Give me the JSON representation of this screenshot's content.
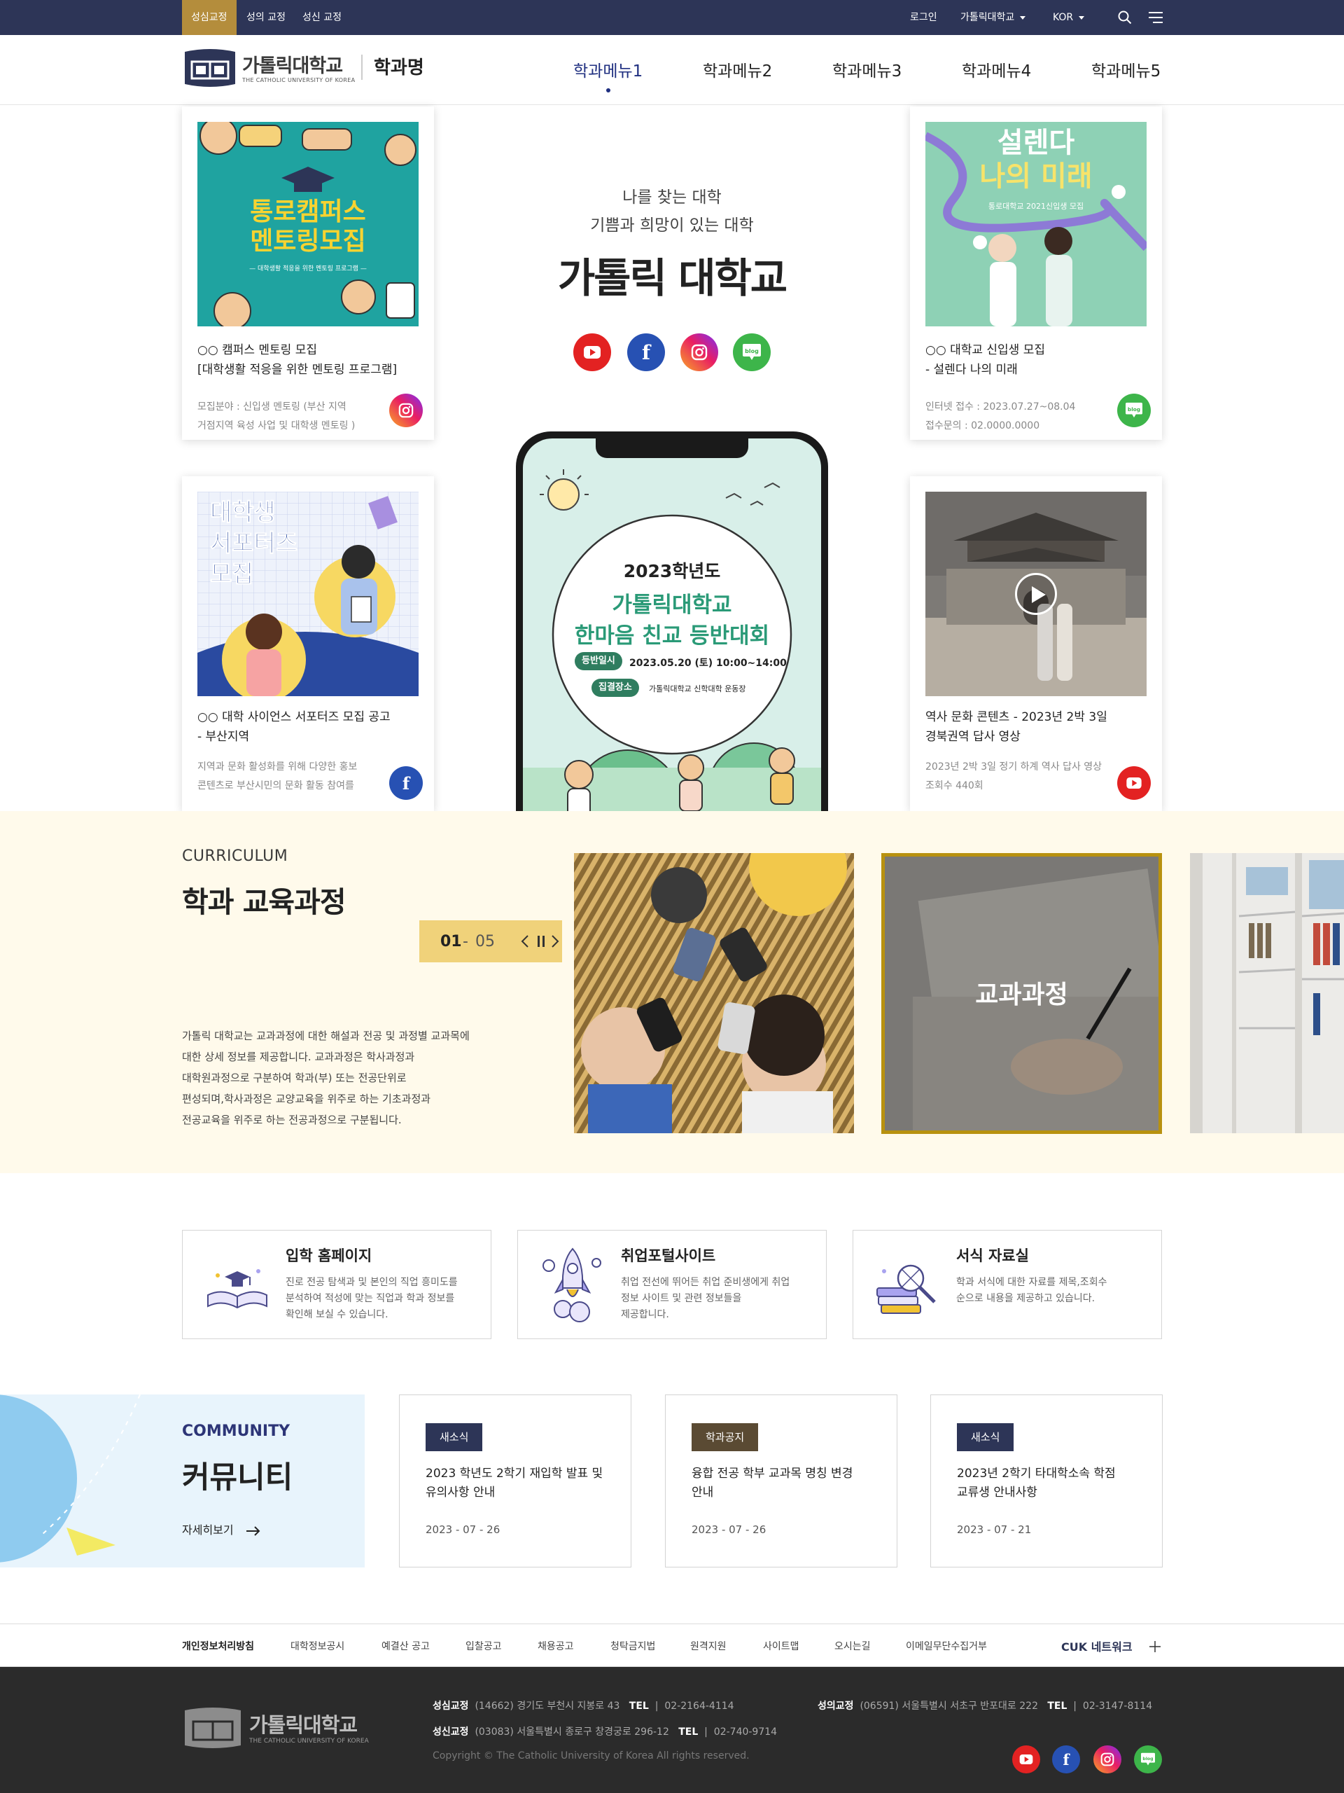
{
  "util": {
    "campuses": [
      "성심교정",
      "성의 교정",
      "성신 교정"
    ],
    "login": "로그인",
    "univ_select": "가톨릭대학교",
    "lang": "KOR"
  },
  "header": {
    "logo_ko": "가톨릭대학교",
    "logo_en": "THE CATHOLIC UNIVERSITY OF KOREA",
    "dept": "학과명",
    "menus": [
      "학과메뉴1",
      "학과메뉴2",
      "학과메뉴3",
      "학과메뉴4",
      "학과메뉴5"
    ]
  },
  "intro": {
    "line1": "나를 찾는 대학",
    "line2": "기쁨과 희망이 있는 대학",
    "title": "가톨릭 대학교"
  },
  "cards": [
    {
      "thumb_l1": "통로캠퍼스",
      "thumb_l2": "멘토링모집",
      "thumb_sub": "— 대학생활 적응을 위한 멘토링 프로그램 —",
      "title_l1": "○○ 캠퍼스 멘토링 모집",
      "title_l2": "[대학생활 적응을 위한 멘토링 프로그램]",
      "desc_l1": "모집분야 : 신입생 멘토링 (부산 지역",
      "desc_l2": "거점지역 육성 사업 및 대학생 멘토링 )",
      "sns": "instagram-icon"
    },
    {
      "thumb_l1": "설렌다",
      "thumb_l2": "나의 미래",
      "thumb_sub": "통로대학교 2021신입생 모집",
      "title_l1": "○○ 대학교 신입생 모집",
      "title_l2": "- 설렌다 나의 미래",
      "desc_l1": "인터넷 접수 : 2023.07.27~08.04",
      "desc_l2": "접수문의 : 02.0000.0000",
      "sns": "blog-icon"
    },
    {
      "thumb_l1": "대학생",
      "thumb_l2": "서포터즈",
      "thumb_l3": "모집",
      "title_l1": "○○ 대학 사이언스 서포터즈 모집 공고",
      "title_l2": "- 부산지역",
      "desc_l1": "지역과 문화 활성화를 위해 다양한 홍보",
      "desc_l2": "콘텐츠로 부산시민의 문화 활동 참여를",
      "sns": "facebook-icon"
    },
    {
      "title_l1": "역사 문화 콘텐츠 -  2023년 2박 3일",
      "title_l2": "경북권역 답사 영상",
      "desc_l1": "2023년 2박 3일 정기 하계 역사 답사 영상",
      "desc_l2": "조회수 440회",
      "sns": "youtube-icon"
    }
  ],
  "phone": {
    "year": "2023학년도",
    "t1": "가톨릭대학교",
    "t2": "한마음 친교 등반대회",
    "k1": "등반일시",
    "v1": "2023.05.20 (토) 10:00~14:00",
    "k2": "집결장소",
    "v2": "가톨릭대학교 신학대학 운동장"
  },
  "curriculum": {
    "eyebrow": "CURRICULUM",
    "title": "학과 교육과정",
    "page_cur": "01",
    "page_sep": "-",
    "page_total": "05",
    "desc": [
      "가톨릭 대학교는 교과과정에 대한 해설과 전공 및 과정별 교과목에",
      "대한 상세 정보를 제공합니다. 교과과정은 학사과정과",
      "대학원과정으로 구분하여 학과(부) 또는 전공단위로",
      "편성되며,학사과정은 교양교육을 위주로 하는 기초과정과",
      "전공교육을 위주로 하는 전공과정으로 구분됩니다."
    ],
    "slide_label": "교과과정"
  },
  "quick": [
    {
      "title": "입학 홈페이지",
      "desc": [
        "진로 전공 탐색과 및 본인의 직업 흥미도를",
        "분석하여 적성에 맞는 직업과 학과 정보를",
        "확인해 보실 수 있습니다."
      ],
      "icon": "book-graduation-icon"
    },
    {
      "title": "취업포털사이트",
      "desc": [
        "취업 전선에 뛰어든 취업 준비생에게 취업",
        "정보 사이트 및 관련 정보들을",
        "제공합니다."
      ],
      "icon": "rocket-icon"
    },
    {
      "title": "서식 자료실",
      "desc": [
        "학과 서식에 대한 자료를 제목,조회수",
        "순으로 내용을 제공하고 있습니다."
      ],
      "icon": "books-search-icon"
    }
  ],
  "community": {
    "eyebrow": "COMMUNITY",
    "title": "커뮤니티",
    "more": "자세히보기",
    "items": [
      {
        "tag": "새소식",
        "tag_color": "#2d3557",
        "title": [
          "2023 학년도 2학기 재입학 발표 및",
          "유의사항 안내"
        ],
        "date": "2023 - 07 - 26"
      },
      {
        "tag": "학과공지",
        "tag_color": "#5a4a33",
        "title": [
          "융합 전공 학부 교과목 명칭 변경",
          "안내"
        ],
        "date": "2023 - 07 - 26"
      },
      {
        "tag": "새소식",
        "tag_color": "#2d3557",
        "title": [
          "2023년 2학기 타대학소속 학점",
          "교류생 안내사항"
        ],
        "date": "2023 - 07 - 21"
      }
    ]
  },
  "footer_links": [
    "개인정보처리방침",
    "대학정보공시",
    "예결산 공고",
    "입찰공고",
    "채용공고",
    "청탁금지법",
    "원격지원",
    "사이트맵",
    "오시는길",
    "이메일무단수집거부"
  ],
  "cuk_network": "CUK 네트워크",
  "footer": {
    "logo_ko": "가톨릭대학교",
    "logo_en": "THE CATHOLIC UNIVERSITY OF KOREA",
    "c1_name": "성심교정",
    "c1_addr": "(14662) 경기도 부천시 지봉로 43",
    "c1_tel_label": "TEL",
    "c1_tel": "02-2164-4114",
    "c2_name": "성의교정",
    "c2_addr": "(06591) 서울특별시 서초구 반포대로 222",
    "c2_tel_label": "TEL",
    "c2_tel": "02-3147-8114",
    "c3_name": "성신교정",
    "c3_addr": "(03083) 서울특별시 종로구 창경궁로 296-12",
    "c3_tel_label": "TEL",
    "c3_tel": "02-740-9714",
    "copyright": "Copyright © The Catholic University of Korea All rights reserved."
  },
  "colors": {
    "navy": "#2d3557",
    "gold": "#b48d3c",
    "cream": "#fffaeb",
    "menu_active": "#1f2f80"
  }
}
